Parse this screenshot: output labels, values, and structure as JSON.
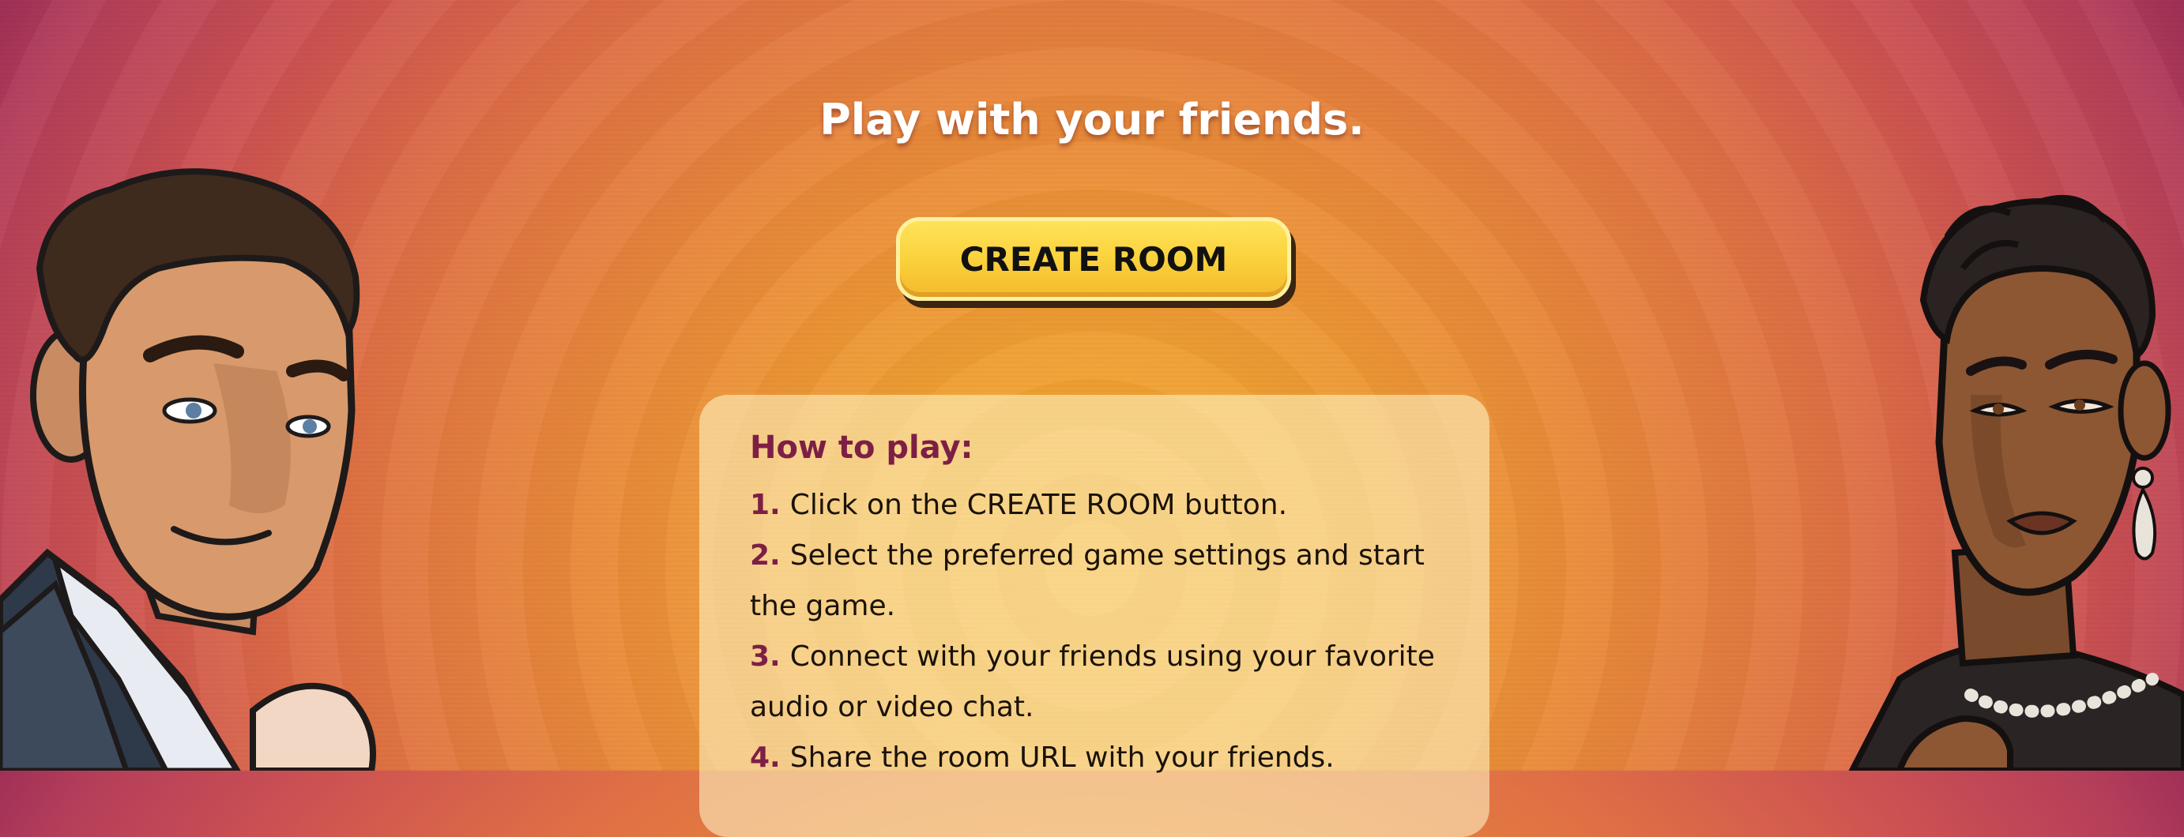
{
  "headline": "Play with your friends.",
  "create_button_label": "CREATE ROOM",
  "how_to": {
    "title": "How to play:",
    "steps": [
      {
        "num": "1.",
        "text": "Click on the CREATE ROOM button."
      },
      {
        "num": "2.",
        "text": "Select the preferred game settings and start the game."
      },
      {
        "num": "3.",
        "text": "Connect with your friends using your favorite audio or video chat."
      },
      {
        "num": "4.",
        "text": "Share the room URL with your friends."
      }
    ]
  },
  "colors": {
    "button": "#fbd43f",
    "accent": "#7d1f45",
    "background_center": "#f3a62f",
    "background_edge": "#8e2455"
  },
  "illustrations": [
    "man-in-suit-illustration",
    "woman-with-earrings-illustration"
  ]
}
